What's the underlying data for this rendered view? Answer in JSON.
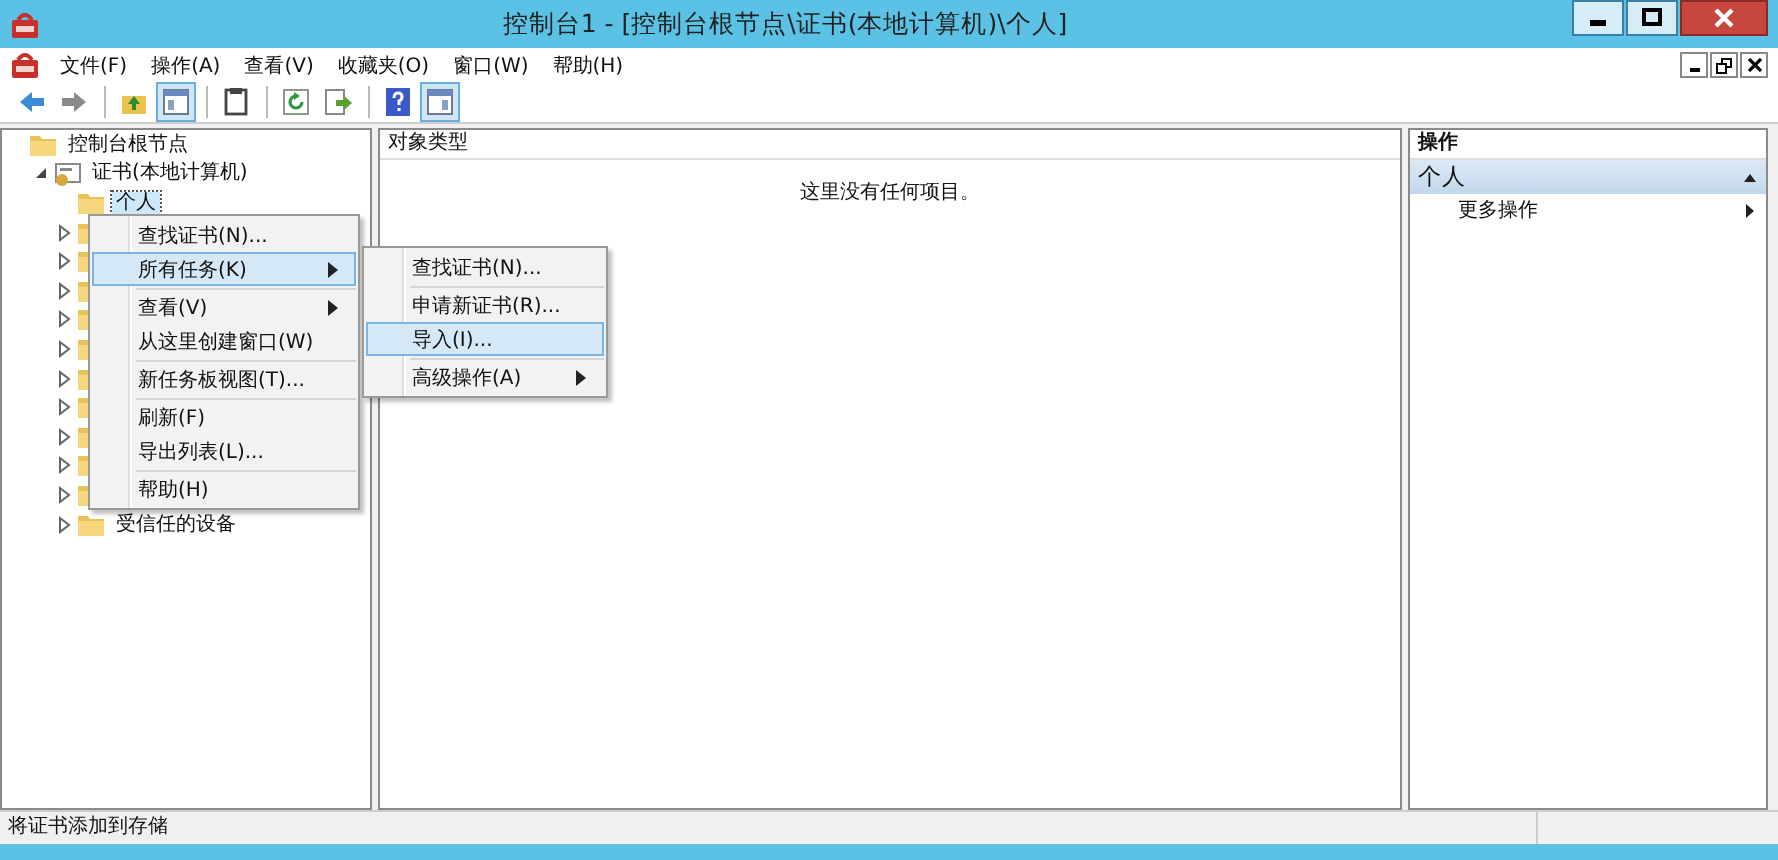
{
  "window": {
    "title": "控制台1 - [控制台根节点\\证书(本地计算机)\\个人]"
  },
  "menu_bar": [
    "文件(F)",
    "操作(A)",
    "查看(V)",
    "收藏夹(O)",
    "窗口(W)",
    "帮助(H)"
  ],
  "toolbar": [
    {
      "kind": "back",
      "pressed": false
    },
    {
      "kind": "forward",
      "pressed": false
    },
    {
      "kind": "separator"
    },
    {
      "kind": "up",
      "pressed": false
    },
    {
      "kind": "tree",
      "pressed": true
    },
    {
      "kind": "separator"
    },
    {
      "kind": "properties",
      "pressed": false
    },
    {
      "kind": "separator"
    },
    {
      "kind": "refresh",
      "pressed": false
    },
    {
      "kind": "export",
      "pressed": false
    },
    {
      "kind": "separator"
    },
    {
      "kind": "help",
      "pressed": false
    },
    {
      "kind": "pane",
      "pressed": true
    }
  ],
  "tree": [
    {
      "label": "控制台根节点",
      "kind": "folder",
      "selected": false,
      "children": [
        {
          "label": "证书(本地计算机)",
          "kind": "cert",
          "expanded": true,
          "selected": false,
          "children": [
            {
              "label": "个人",
              "kind": "folder",
              "selected": true
            },
            {
              "kind": "folder",
              "expanded": false
            },
            {
              "kind": "folder",
              "expanded": false
            },
            {
              "kind": "folder",
              "expanded": false
            },
            {
              "kind": "folder",
              "expanded": false
            },
            {
              "kind": "folder",
              "expanded": false
            },
            {
              "kind": "folder",
              "expanded": false
            },
            {
              "kind": "folder",
              "expanded": false
            },
            {
              "kind": "folder",
              "expanded": false
            },
            {
              "kind": "folder",
              "expanded": false
            },
            {
              "kind": "folder",
              "expanded": false
            },
            {
              "label": "受信任的设备",
              "kind": "folder",
              "expanded": false,
              "selected": false
            }
          ]
        }
      ]
    }
  ],
  "list": {
    "column_header": "对象类型",
    "empty_message": "这里没有任何项目。"
  },
  "actions": {
    "header": "操作",
    "section": "个人",
    "items": [
      "更多操作"
    ]
  },
  "context_menu": [
    {
      "kind": "item",
      "label": "查找证书(N)...",
      "selected": false,
      "submenu": false
    },
    {
      "kind": "item",
      "label": "所有任务(K)",
      "selected": true,
      "submenu": true
    },
    {
      "kind": "separator"
    },
    {
      "kind": "item",
      "label": "查看(V)",
      "selected": false,
      "submenu": true
    },
    {
      "kind": "item",
      "label": "从这里创建窗口(W)",
      "selected": false,
      "submenu": false
    },
    {
      "kind": "separator"
    },
    {
      "kind": "item",
      "label": "新任务板视图(T)...",
      "selected": false,
      "submenu": false
    },
    {
      "kind": "separator"
    },
    {
      "kind": "item",
      "label": "刷新(F)",
      "selected": false,
      "submenu": false
    },
    {
      "kind": "item",
      "label": "导出列表(L)...",
      "selected": false,
      "submenu": false
    },
    {
      "kind": "separator"
    },
    {
      "kind": "item",
      "label": "帮助(H)",
      "selected": false,
      "submenu": false
    }
  ],
  "submenu": [
    {
      "kind": "item",
      "label": "查找证书(N)...",
      "selected": false,
      "submenu": false
    },
    {
      "kind": "separator"
    },
    {
      "kind": "item",
      "label": "申请新证书(R)...",
      "selected": false,
      "submenu": false
    },
    {
      "kind": "item",
      "label": "导入(I)...",
      "selected": true,
      "submenu": false
    },
    {
      "kind": "separator"
    },
    {
      "kind": "item",
      "label": "高级操作(A)",
      "selected": false,
      "submenu": true
    }
  ],
  "status_bar": "将证书添加到存储"
}
